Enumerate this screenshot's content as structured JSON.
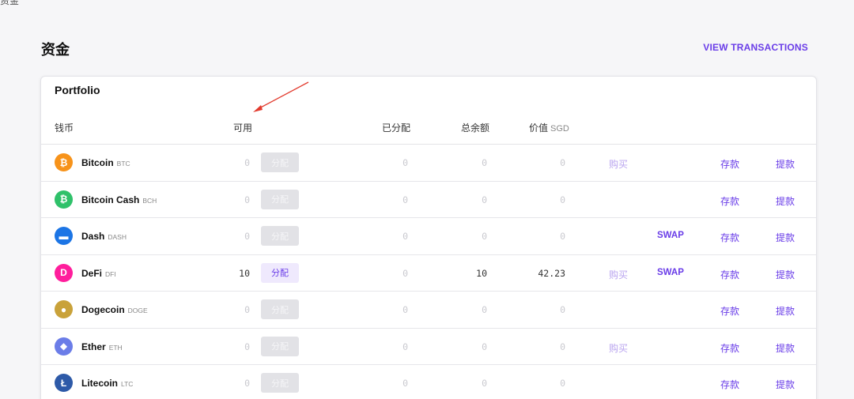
{
  "page": {
    "corner_text": "资金",
    "title": "资金",
    "view_transactions": "VIEW TRANSACTIONS"
  },
  "colors": {
    "accent": "#6a3de8",
    "annotation_arrow": "#e23b2e"
  },
  "portfolio": {
    "title": "Portfolio",
    "headers": {
      "currency": "钱币",
      "available": "可用",
      "allocated": "已分配",
      "total": "总余额",
      "value": "价值",
      "value_unit": "SGD"
    },
    "alloc_label": "分配",
    "buy_label": "购买",
    "swap_label": "SWAP",
    "deposit_label": "存款",
    "withdraw_label": "提款",
    "rows": [
      {
        "name": "Bitcoin",
        "symbol": "BTC",
        "icon": "bitcoin-icon",
        "color": "#f7931a",
        "glyph": "₿",
        "available": "0",
        "allocated": "0",
        "total": "0",
        "value": "0",
        "buy": true,
        "swap": false,
        "active": false
      },
      {
        "name": "Bitcoin Cash",
        "symbol": "BCH",
        "icon": "bitcoin-cash-icon",
        "color": "#2fc16a",
        "glyph": "₿",
        "available": "0",
        "allocated": "0",
        "total": "0",
        "value": "0",
        "buy": false,
        "swap": false,
        "active": false
      },
      {
        "name": "Dash",
        "symbol": "DASH",
        "icon": "dash-icon",
        "color": "#1c75e5",
        "glyph": "▬",
        "available": "0",
        "allocated": "0",
        "total": "0",
        "value": "0",
        "buy": false,
        "swap": true,
        "active": false
      },
      {
        "name": "DeFi",
        "symbol": "DFI",
        "icon": "defi-icon",
        "color": "#ff1e9c",
        "glyph": "D",
        "available": "10",
        "allocated": "0",
        "total": "10",
        "value": "42.23",
        "buy": true,
        "swap": true,
        "active": true
      },
      {
        "name": "Dogecoin",
        "symbol": "DOGE",
        "icon": "dogecoin-icon",
        "color": "#c9a23a",
        "glyph": "●",
        "available": "0",
        "allocated": "0",
        "total": "0",
        "value": "0",
        "buy": false,
        "swap": false,
        "active": false
      },
      {
        "name": "Ether",
        "symbol": "ETH",
        "icon": "ether-icon",
        "color": "#6b7de8",
        "glyph": "◆",
        "available": "0",
        "allocated": "0",
        "total": "0",
        "value": "0",
        "buy": true,
        "swap": false,
        "active": false
      },
      {
        "name": "Litecoin",
        "symbol": "LTC",
        "icon": "litecoin-icon",
        "color": "#2e5aa8",
        "glyph": "Ł",
        "available": "0",
        "allocated": "0",
        "total": "0",
        "value": "0",
        "buy": false,
        "swap": false,
        "active": false
      }
    ]
  }
}
